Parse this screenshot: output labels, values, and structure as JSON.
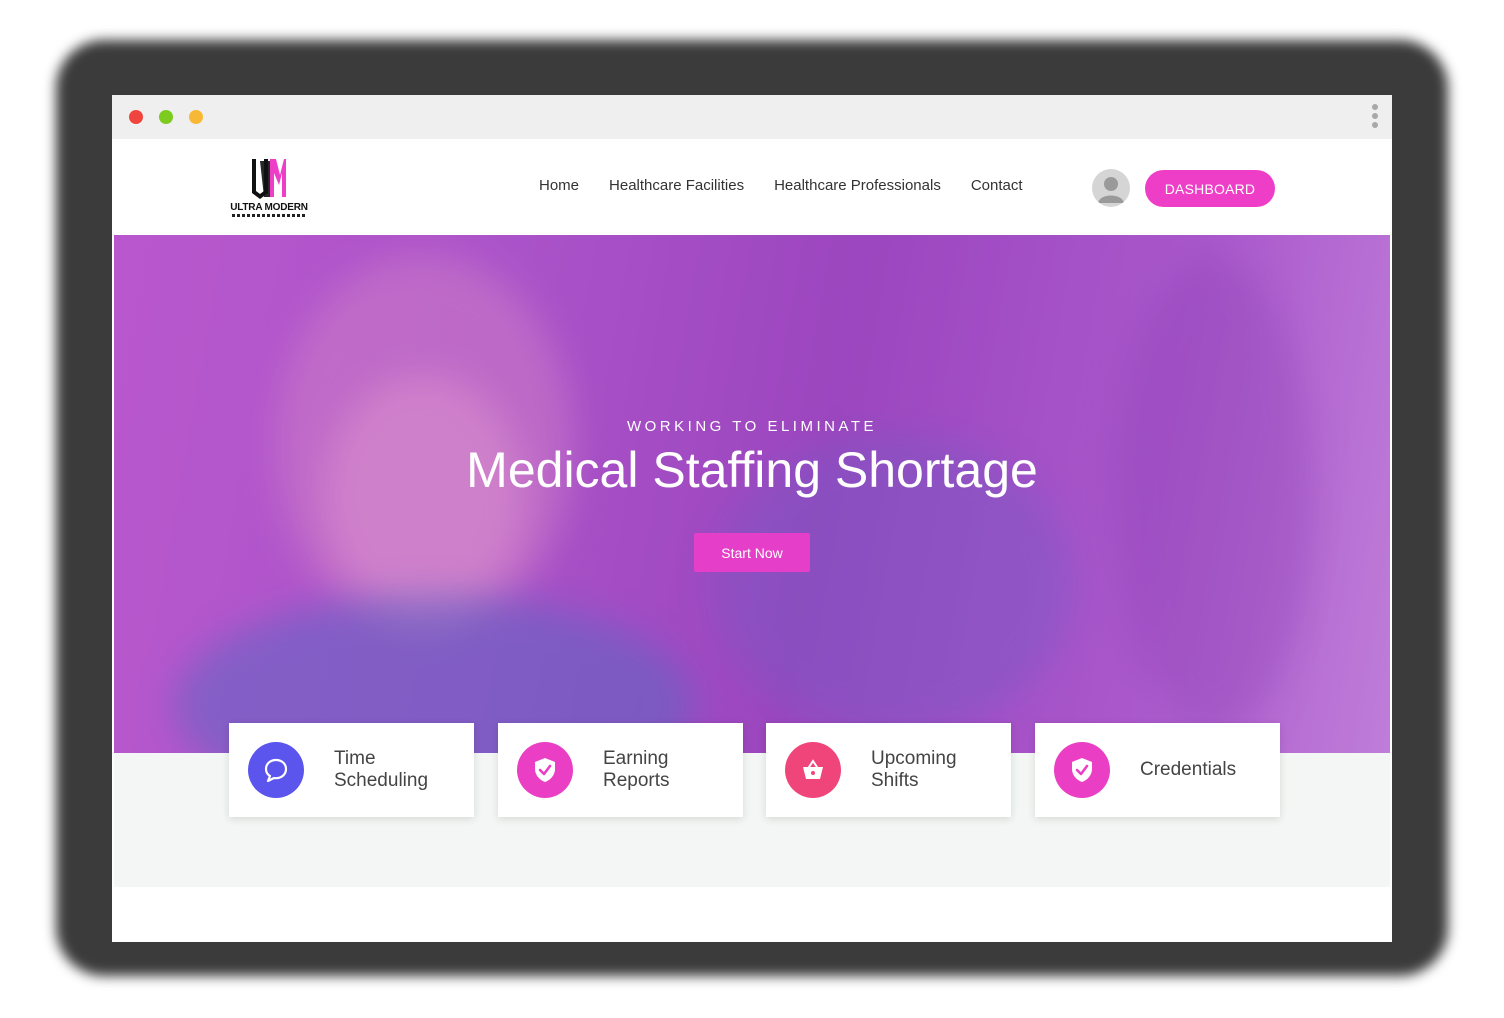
{
  "window": {
    "controls": [
      "close",
      "minimize",
      "maximize"
    ],
    "menu_icon": "kebab-menu-icon"
  },
  "brand": {
    "logo_text": "ULTRA MODERN",
    "colors": {
      "primary": "#ee3ec8",
      "hero_tint": "#b85cc9"
    }
  },
  "nav": {
    "items": [
      {
        "label": "Home"
      },
      {
        "label": "Healthcare Facilities"
      },
      {
        "label": "Healthcare Professionals"
      },
      {
        "label": "Contact"
      }
    ],
    "avatar_icon": "user-avatar-icon",
    "dashboard_label": "DASHBOARD"
  },
  "hero": {
    "kicker": "WORKING TO ELIMINATE",
    "title": "Medical Staffing Shortage",
    "cta_label": "Start Now"
  },
  "features": [
    {
      "label": "Time Scheduling",
      "icon": "chat-bubble-icon",
      "color": "#5b55ee"
    },
    {
      "label": "Earning Reports",
      "icon": "shield-check-icon",
      "color": "#ea3fc4"
    },
    {
      "label": "Upcoming Shifts",
      "icon": "shopping-basket-icon",
      "color": "#f0457b"
    },
    {
      "label": "Credentials",
      "icon": "shield-check-icon",
      "color": "#ea3fc4"
    }
  ]
}
